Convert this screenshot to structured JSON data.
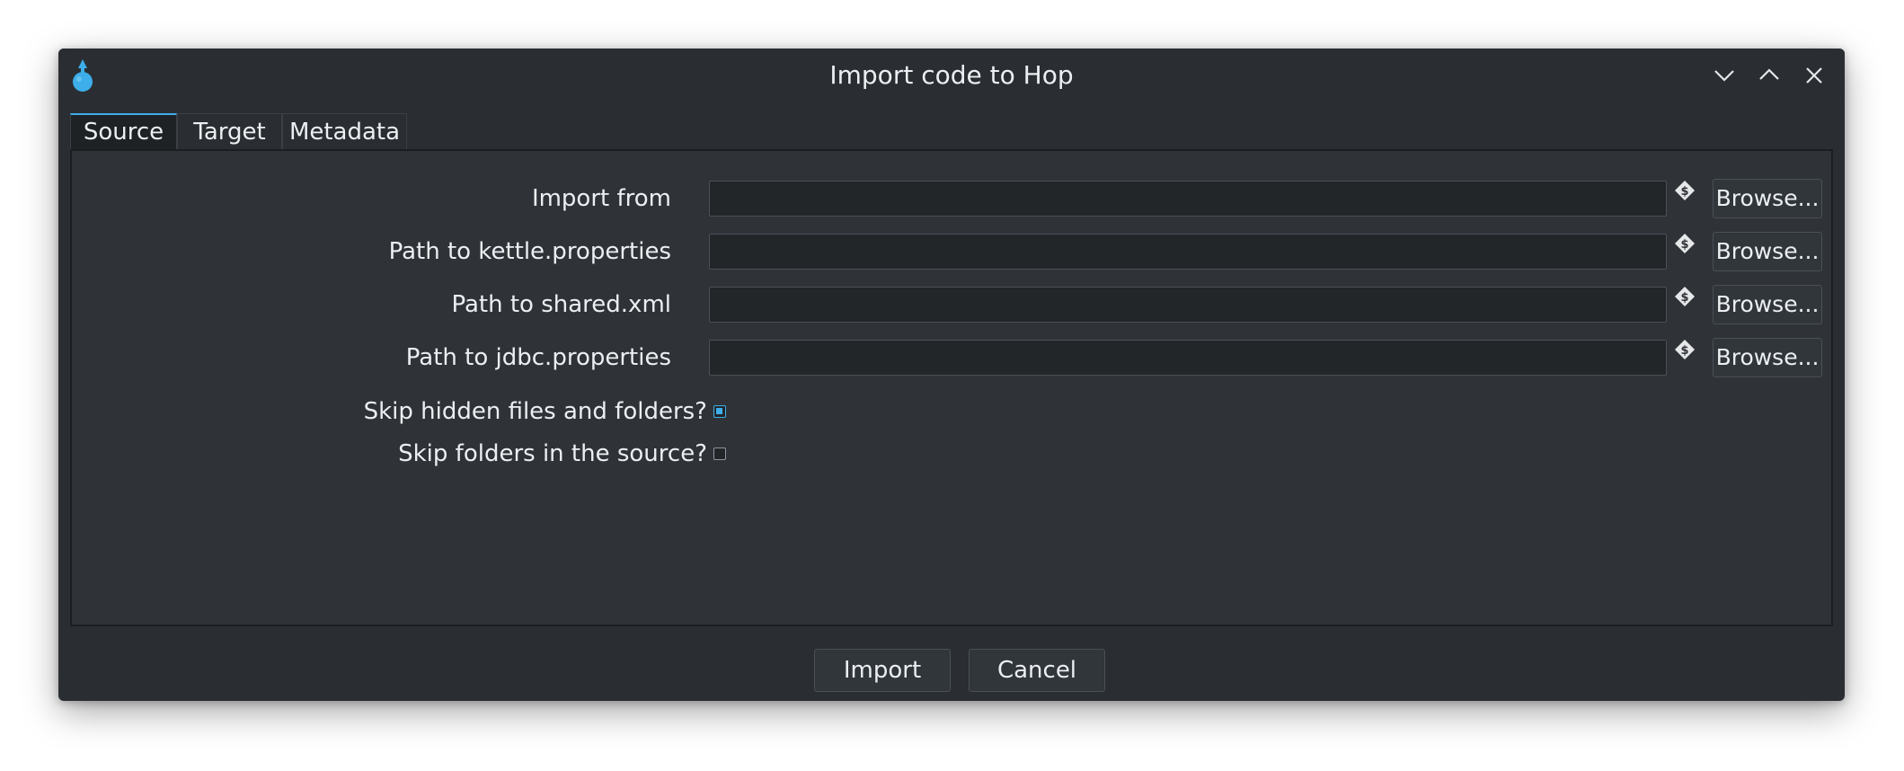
{
  "window": {
    "title": "Import code to Hop",
    "app_icon": "hop-icon",
    "controls": [
      "minimize-icon",
      "maximize-icon",
      "close-icon"
    ]
  },
  "tabs": [
    {
      "label": "Source",
      "active": true
    },
    {
      "label": "Target",
      "active": false
    },
    {
      "label": "Metadata",
      "active": false
    }
  ],
  "source": {
    "fields": [
      {
        "label": "Import from",
        "value": "",
        "browse_label": "Browse..."
      },
      {
        "label": "Path to kettle.properties",
        "value": "",
        "browse_label": "Browse..."
      },
      {
        "label": "Path to shared.xml",
        "value": "",
        "browse_label": "Browse..."
      },
      {
        "label": "Path to jdbc.properties",
        "value": "",
        "browse_label": "Browse..."
      }
    ],
    "variable_icon": "variable-dollar-icon",
    "checkboxes": [
      {
        "label": "Skip hidden files and folders?",
        "checked": true
      },
      {
        "label": "Skip folders in the source?",
        "checked": false
      }
    ]
  },
  "actions": {
    "import_label": "Import",
    "cancel_label": "Cancel"
  },
  "colors": {
    "accent": "#3daee9",
    "window_bg": "#2a2e32",
    "panel_bg": "#2f3338",
    "field_bg": "#232629",
    "text": "#eceff1"
  }
}
